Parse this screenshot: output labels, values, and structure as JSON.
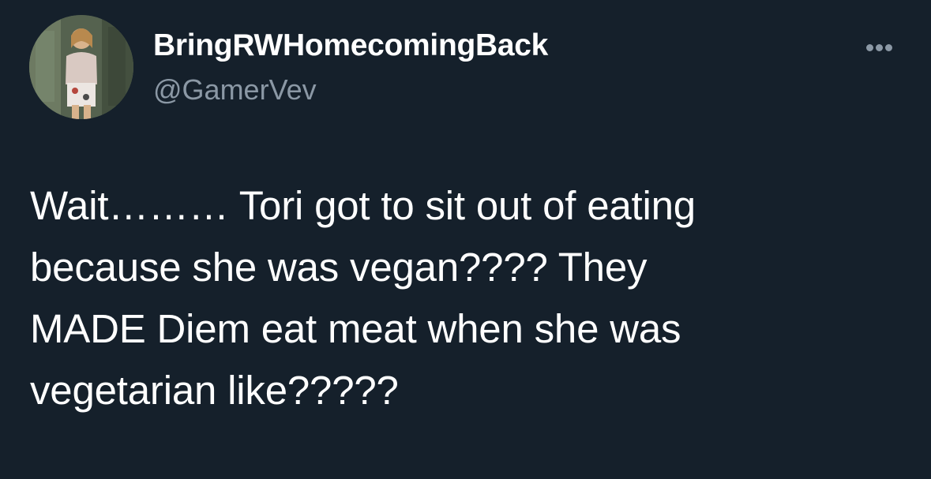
{
  "tweet": {
    "author": {
      "display_name": "BringRWHomecomingBack",
      "handle": "@GamerVev",
      "avatar_icon": "profile-photo"
    },
    "more_icon": "more-options-icon",
    "text_lines": [
      "Wait……… Tori got to sit out of eating",
      "because she was vegan???? They",
      "MADE Diem eat meat when she was",
      "vegetarian like?????"
    ]
  },
  "colors": {
    "background": "#15202b",
    "text_primary": "#ffffff",
    "text_secondary": "#8b98a5"
  }
}
